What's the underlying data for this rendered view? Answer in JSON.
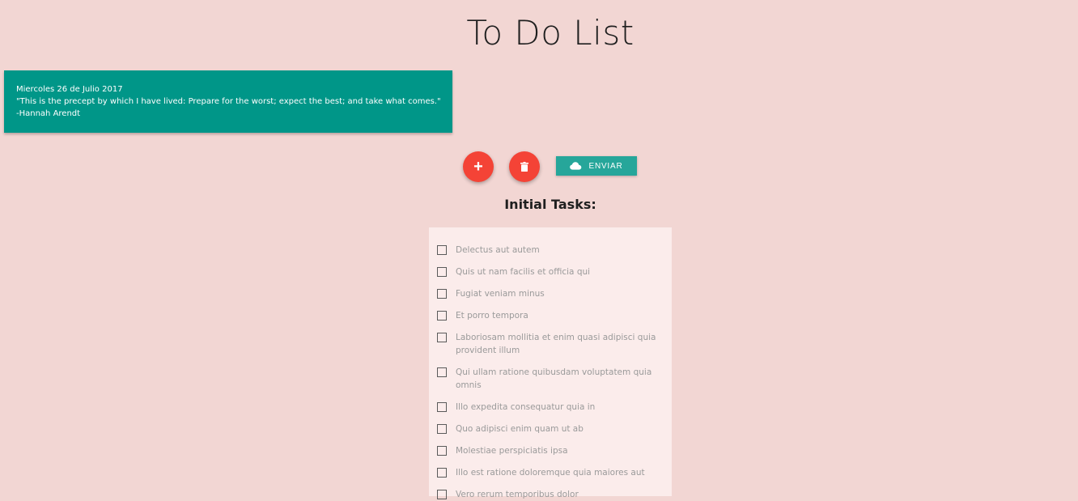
{
  "header": {
    "title": "To Do List"
  },
  "quote_card": {
    "date": "Miercoles 26 de Julio 2017",
    "quote": "\"This is the precept by which I have lived: Prepare for the worst; expect the best; and take what comes.\"",
    "author": "-Hannah Arendt",
    "background_color": "#009688"
  },
  "actions": {
    "add_icon": "plus-icon",
    "delete_icon": "trash-icon",
    "send_icon": "cloud-icon",
    "send_label": "ENVIAR",
    "fab_color": "#f44336",
    "send_color": "#26a69a"
  },
  "tasks_section": {
    "heading": "Initial Tasks:",
    "items": [
      {
        "label": "Delectus aut autem",
        "checked": false
      },
      {
        "label": "Quis ut nam facilis et officia qui",
        "checked": false
      },
      {
        "label": "Fugiat veniam minus",
        "checked": false
      },
      {
        "label": "Et porro tempora",
        "checked": false
      },
      {
        "label": "Laboriosam mollitia et enim quasi adipisci quia provident illum",
        "checked": false
      },
      {
        "label": "Qui ullam ratione quibusdam voluptatem quia omnis",
        "checked": false
      },
      {
        "label": "Illo expedita consequatur quia in",
        "checked": false
      },
      {
        "label": "Quo adipisci enim quam ut ab",
        "checked": false
      },
      {
        "label": "Molestiae perspiciatis ipsa",
        "checked": false
      },
      {
        "label": "Illo est ratione doloremque quia maiores aut",
        "checked": false
      },
      {
        "label": "Vero rerum temporibus dolor",
        "checked": false
      }
    ]
  }
}
